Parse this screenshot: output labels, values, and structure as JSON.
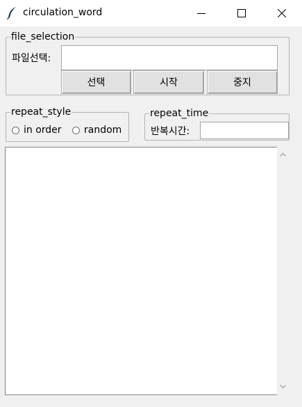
{
  "window": {
    "title": "circulation_word",
    "controls": {
      "minimize_icon": "minimize-icon",
      "maximize_icon": "maximize-icon",
      "close_icon": "close-icon"
    }
  },
  "file_selection": {
    "group_label": "file_selection",
    "file_label": "파일선택:",
    "file_value": "",
    "buttons": {
      "select": "선택",
      "start": "시작",
      "stop": "중지"
    }
  },
  "repeat_style": {
    "group_label": "repeat_style",
    "options": [
      "in order",
      "random"
    ],
    "selected": null
  },
  "repeat_time": {
    "group_label": "repeat_time",
    "label": "반복시간:",
    "value": ""
  },
  "output": {
    "text": ""
  }
}
